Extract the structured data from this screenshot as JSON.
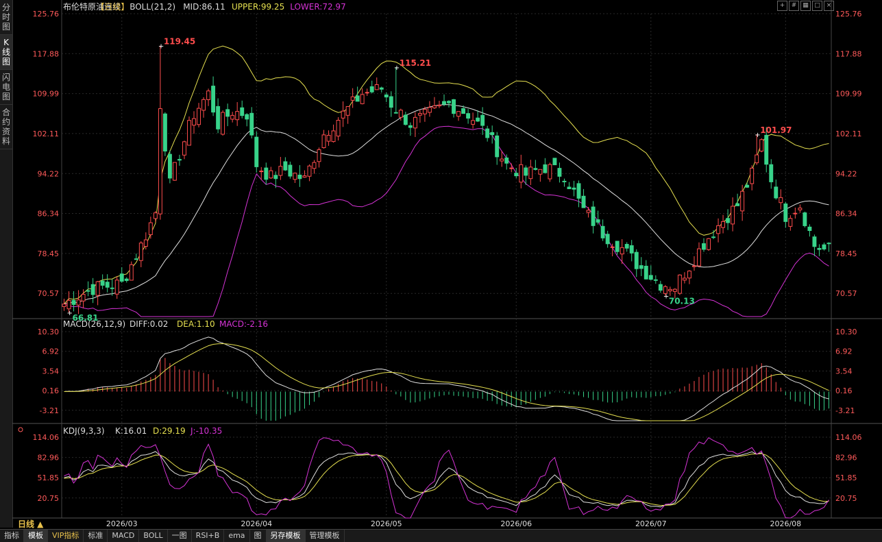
{
  "sidebar": {
    "tabs": [
      {
        "label": "分时图",
        "active": false
      },
      {
        "label": "K线图",
        "active": true
      },
      {
        "label": "闪电图",
        "active": false
      },
      {
        "label": "合约资料",
        "active": false
      }
    ]
  },
  "header": {
    "instrument": "布伦特原油连续",
    "period": "【日线】",
    "boll_label": "BOLL(21,2)",
    "mid_label": "MID:86.11",
    "upper_label": "UPPER:99.25",
    "lower_label": "LOWER:72.97"
  },
  "macd_header": {
    "name": "MACD(26,12,9)",
    "diff": "DIFF:0.02",
    "dea": "DEA:1.10",
    "macd": "MACD:-2.16"
  },
  "kdj_header": {
    "name": "KDJ(9,3,3)",
    "k": "K:16.01",
    "d": "D:29.19",
    "j": "J:-10.35"
  },
  "period_label": "日线 ▲",
  "bottom_tabs": [
    {
      "label": "指标",
      "active": false,
      "vip": false
    },
    {
      "label": "模板",
      "active": true,
      "vip": false
    },
    {
      "label": "VIP指标",
      "active": false,
      "vip": true
    },
    {
      "label": "标准",
      "active": false,
      "vip": false
    },
    {
      "label": "MACD",
      "active": false,
      "vip": false
    },
    {
      "label": "BOLL",
      "active": false,
      "vip": false
    },
    {
      "label": "一图",
      "active": false,
      "vip": false
    },
    {
      "label": "RSI+B",
      "active": false,
      "vip": false
    },
    {
      "label": "ema",
      "active": false,
      "vip": false
    },
    {
      "label": "图",
      "active": false,
      "vip": false
    },
    {
      "label": "另存模板",
      "active": true,
      "vip": false
    },
    {
      "label": "管理模板",
      "active": false,
      "vip": false
    }
  ],
  "colors": {
    "up": "#ff4d4d",
    "down": "#38d38a",
    "mid": "#e0e0e0",
    "upper": "#e6e050",
    "lower": "#d633d6",
    "price_label": "#ff4d4d",
    "axis_text": "#ff5a5a",
    "grid": "#2a2a2a"
  },
  "chart_data": [
    {
      "type": "candlestick",
      "title": "布伦特原油连续",
      "y_ticks": [
        "125.76",
        "117.88",
        "109.99",
        "102.11",
        "94.22",
        "86.34",
        "78.45",
        "70.57"
      ],
      "ylim": [
        66.0,
        125.76
      ],
      "x_tick_labels": [
        "2026/03",
        "2026/04",
        "2026/05",
        "2026/06",
        "2026/07",
        "2026/08"
      ],
      "x_tick_index": [
        12,
        40,
        67,
        94,
        122,
        150
      ],
      "n_bars": 160,
      "annotations": [
        {
          "text": "119.45",
          "index": 20,
          "value": 119.45,
          "kind": "high"
        },
        {
          "text": "66.81",
          "index": 1,
          "value": 66.81,
          "kind": "low"
        },
        {
          "text": "115.21",
          "index": 69,
          "value": 115.21,
          "kind": "high"
        },
        {
          "text": "70.13",
          "index": 125,
          "value": 70.13,
          "kind": "low"
        },
        {
          "text": "101.97",
          "index": 144,
          "value": 101.97,
          "kind": "high"
        }
      ],
      "close_anchors": [
        [
          0,
          68.5
        ],
        [
          6,
          71.6
        ],
        [
          12,
          72.5
        ],
        [
          16,
          80.0
        ],
        [
          19,
          86.5
        ],
        [
          20,
          108.0
        ],
        [
          22,
          92.0
        ],
        [
          24,
          98.0
        ],
        [
          27,
          106.0
        ],
        [
          30,
          110.0
        ],
        [
          32,
          104.0
        ],
        [
          35,
          106.5
        ],
        [
          38,
          106.0
        ],
        [
          40,
          96.0
        ],
        [
          43,
          93.5
        ],
        [
          46,
          95.0
        ],
        [
          50,
          93.0
        ],
        [
          54,
          102.0
        ],
        [
          58,
          106.0
        ],
        [
          62,
          110.0
        ],
        [
          66,
          111.0
        ],
        [
          68,
          108.0
        ],
        [
          72,
          104.0
        ],
        [
          76,
          106.0
        ],
        [
          80,
          108.0
        ],
        [
          84,
          106.0
        ],
        [
          88,
          102.0
        ],
        [
          92,
          96.0
        ],
        [
          96,
          94.0
        ],
        [
          100,
          95.5
        ],
        [
          104,
          94.0
        ],
        [
          108,
          87.0
        ],
        [
          112,
          82.5
        ],
        [
          116,
          79.5
        ],
        [
          120,
          75.5
        ],
        [
          124,
          72.5
        ],
        [
          127,
          72.0
        ],
        [
          130,
          76.0
        ],
        [
          133,
          80.5
        ],
        [
          136,
          84.0
        ],
        [
          140,
          88.0
        ],
        [
          143,
          94.0
        ],
        [
          145,
          100.5
        ],
        [
          147,
          93.0
        ],
        [
          150,
          86.0
        ],
        [
          153,
          88.0
        ],
        [
          156,
          80.0
        ],
        [
          158,
          79.2
        ]
      ],
      "series": [
        {
          "name": "MID",
          "values_label": "MID:86.11"
        },
        {
          "name": "UPPER",
          "values_label": "UPPER:99.25"
        },
        {
          "name": "LOWER",
          "values_label": "LOWER:72.97"
        }
      ]
    },
    {
      "type": "bar",
      "title": "MACD(26,12,9)",
      "y_ticks": [
        "10.30",
        "6.92",
        "3.54",
        "0.16",
        "-3.21"
      ],
      "ylim": [
        -5.0,
        10.3
      ],
      "series": [
        {
          "name": "DIFF"
        },
        {
          "name": "DEA"
        },
        {
          "name": "MACD"
        }
      ]
    },
    {
      "type": "line",
      "title": "KDJ(9,3,3)",
      "y_ticks": [
        "114.06",
        "82.96",
        "51.85",
        "20.75"
      ],
      "ylim": [
        -10.0,
        114.06
      ],
      "series": [
        {
          "name": "K"
        },
        {
          "name": "D"
        },
        {
          "name": "J"
        }
      ]
    }
  ]
}
